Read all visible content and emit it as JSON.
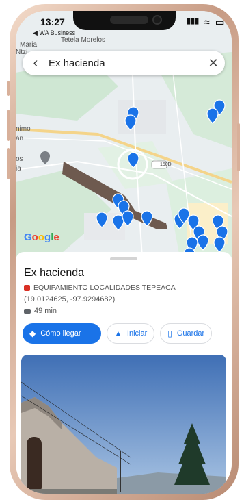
{
  "status_bar": {
    "time": "13:27",
    "carrier": "◀ WA Business",
    "signal": "▮▮▮",
    "wifi": "≈",
    "battery": "▭"
  },
  "map": {
    "place_labels": [
      "Tetela Morelos",
      "Maria",
      "nimo",
      "án",
      "os",
      "ia",
      "Ntzi"
    ],
    "road_badge": "150D",
    "google_logo": "Google"
  },
  "search": {
    "query": "Ex hacienda",
    "back_icon": "chevron-left-icon",
    "clear_icon": "close-icon"
  },
  "place": {
    "title": "Ex hacienda",
    "category": "EQUIPAMIENTO LOCALIDADES TEPEACA",
    "coordinates": "(19.0124625, -97.9294682)",
    "drive_time": "49 min"
  },
  "actions": [
    {
      "label": "Cómo llegar",
      "icon": "directions-icon"
    },
    {
      "label": "Iniciar",
      "icon": "navigation-arrow-icon"
    },
    {
      "label": "Guardar",
      "icon": "bookmark-icon"
    }
  ],
  "colors": {
    "accent": "#1a73e8",
    "pin": "#1a73e8",
    "category_icon": "#d93025"
  }
}
